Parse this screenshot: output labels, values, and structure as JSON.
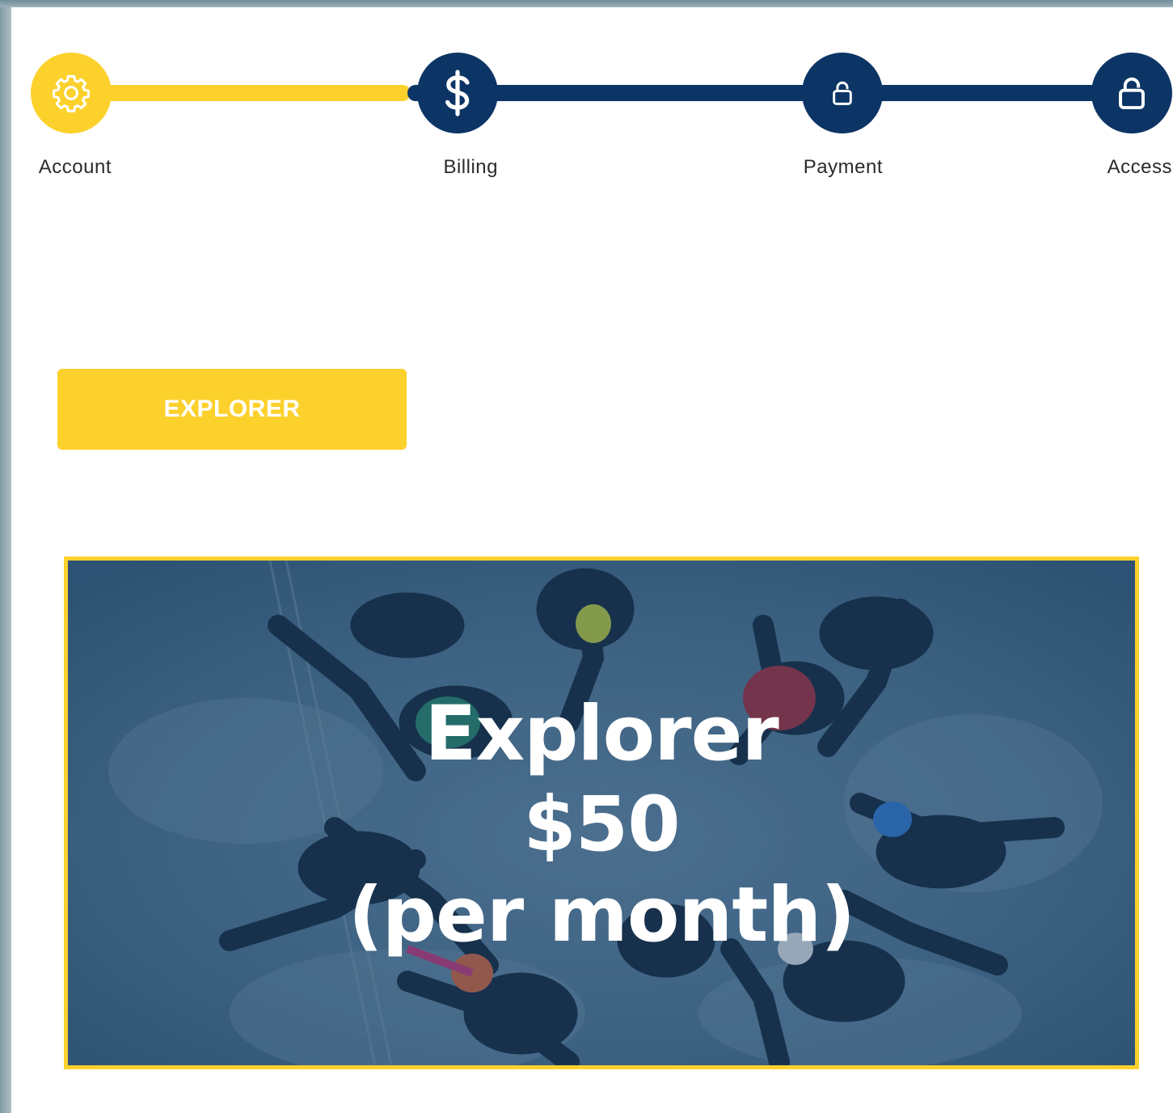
{
  "colors": {
    "accent": "#fcd12c",
    "navy": "#0c3566",
    "hero_overlay": "#123c6a"
  },
  "stepper": {
    "steps": [
      {
        "label": "Account",
        "icon": "gear-icon",
        "state": "complete"
      },
      {
        "label": "Billing",
        "icon": "dollar-icon",
        "state": "active"
      },
      {
        "label": "Payment",
        "icon": "lock-icon",
        "state": "locked"
      },
      {
        "label": "Access",
        "icon": "lock-icon",
        "state": "locked"
      }
    ]
  },
  "plan": {
    "button_label": "EXPLORER",
    "card": {
      "name": "Explorer",
      "price": "$50",
      "period": "(per month)",
      "image": "skydivers-formation-image"
    }
  }
}
